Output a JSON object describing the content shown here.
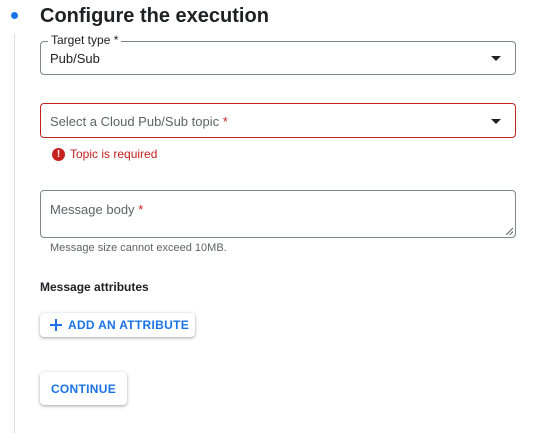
{
  "step": {
    "title": "Configure the execution",
    "accent_color": "#1a73e8"
  },
  "target_type": {
    "label": "Target type *",
    "value": "Pub/Sub",
    "icon": "chevron-down-icon"
  },
  "topic": {
    "placeholder": "Select a Cloud Pub/Sub topic",
    "required_marker": "*",
    "error": "Topic is required",
    "error_color": "#c5221f",
    "icon": "chevron-down-icon"
  },
  "message_body": {
    "placeholder": "Message body",
    "required_marker": "*",
    "hint": "Message size cannot exceed 10MB."
  },
  "attributes": {
    "title": "Message attributes",
    "add_label": "ADD AN ATTRIBUTE"
  },
  "actions": {
    "continue_label": "CONTINUE"
  }
}
